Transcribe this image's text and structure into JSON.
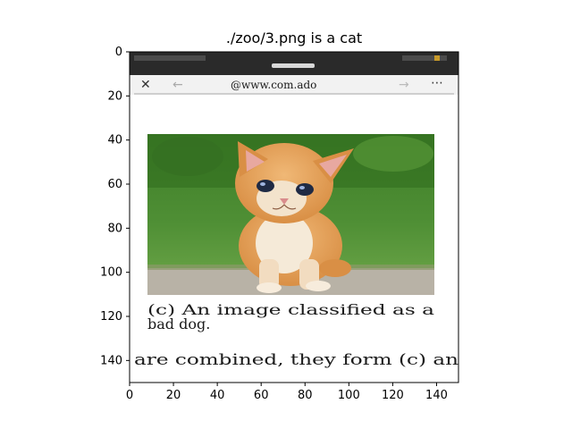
{
  "figure": {
    "title": "./zoo/3.png is a cat"
  },
  "axes": {
    "x_range": [
      0,
      150
    ],
    "y_range": [
      0,
      150
    ],
    "y_inverted": true,
    "x_ticks": [
      "0",
      "20",
      "40",
      "60",
      "80",
      "100",
      "120",
      "140"
    ],
    "y_ticks": [
      "0",
      "20",
      "40",
      "60",
      "80",
      "100",
      "120",
      "140"
    ]
  },
  "image_content": {
    "description_subject": "orange kitten on grass",
    "screenshot_url_text": "@www.com.ado",
    "caption_line1": "(c) An image classified as a",
    "caption_line2": "bad dog.",
    "caption_line3": "are combined, they form (c) an",
    "colors": {
      "status_bar": "#2a2a2a",
      "page_bg": "#ffffff",
      "grass_dark": "#2f6b1e",
      "grass_light": "#6fa84a",
      "kitten_fur": "#e3a25e",
      "kitten_chest": "#f5ead8",
      "ground": "#b8b2a6"
    }
  }
}
